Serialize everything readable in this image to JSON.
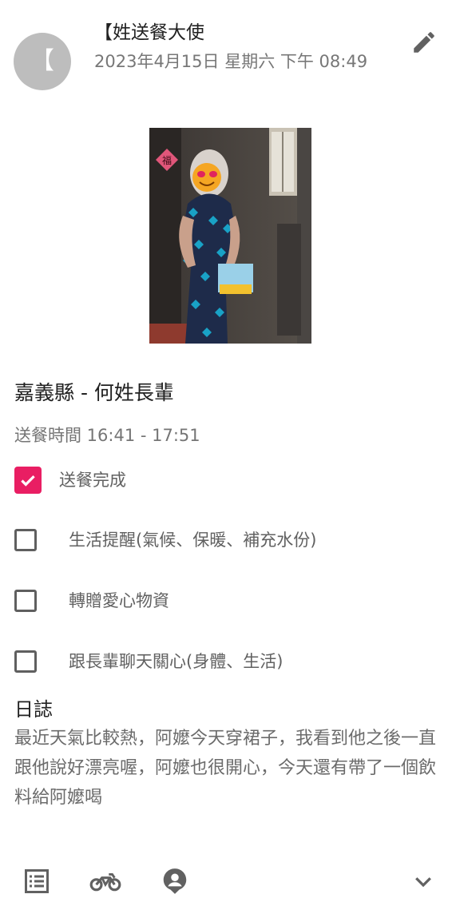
{
  "post": {
    "avatar_initial": "【",
    "author": "【姓送餐大使",
    "date": "2023年4月15日 星期六 下午 08:49"
  },
  "icons": {
    "edit": "pencil-icon",
    "list": "list-icon",
    "bike": "motorbike-icon",
    "person": "person-pin-icon",
    "expand": "chevron-down-icon"
  },
  "photo": {
    "alt": "elderly woman holding a drink box"
  },
  "delivery": {
    "title": "嘉義縣 - 何姓長輩",
    "time": "送餐時間 16:41 - 17:51"
  },
  "checklist": [
    {
      "label": "送餐完成",
      "checked": true
    },
    {
      "label": "生活提醒(氣候、保暖、補充水份)",
      "checked": false
    },
    {
      "label": "轉贈愛心物資",
      "checked": false
    },
    {
      "label": "跟長輩聊天關心(身體、生活)",
      "checked": false
    }
  ],
  "log": {
    "heading": "日誌",
    "body": "最近天氣比較熱，阿嬤今天穿裙子，我看到他之後一直跟他說好漂亮喔，阿嬤也很開心，今天還有帶了一個飲料給阿嬤喝"
  },
  "colors": {
    "accent": "#e91e63",
    "muted_text": "#757575",
    "icon_grey": "#616161"
  }
}
